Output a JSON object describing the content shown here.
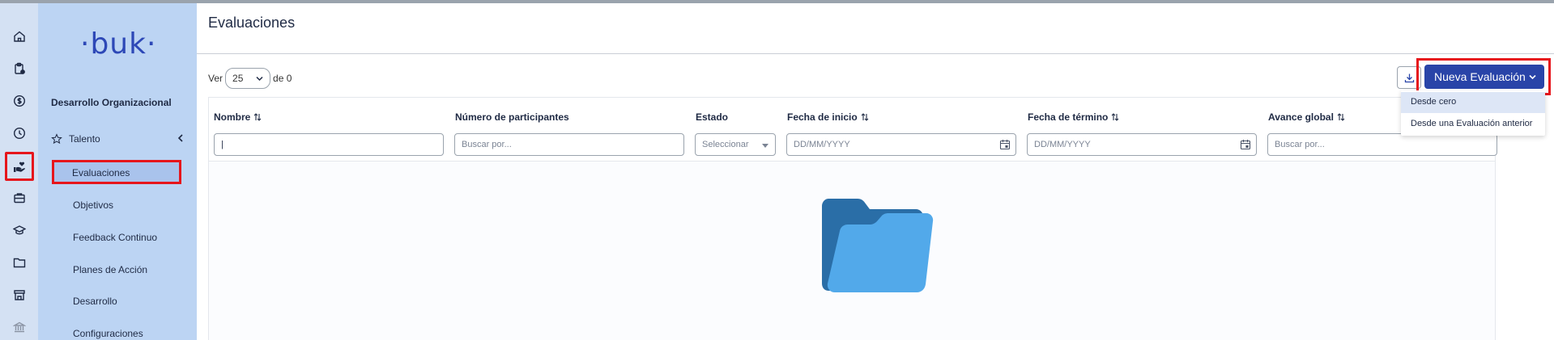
{
  "colors": {
    "brand": "#2944a8",
    "sidebar_bg": "#bcd4f3",
    "rail_bg": "#d4e1f3",
    "highlight": "#e6161c",
    "folder_dark": "#2a6ea7",
    "folder_light": "#52a9ea"
  },
  "app": {
    "logo_text": "·buk·"
  },
  "rail": {
    "icons": [
      "home-icon",
      "clipboard-icon",
      "dollar-icon",
      "clock-icon",
      "hand-heart-icon",
      "briefcase-icon",
      "graduation-cap-icon",
      "folder-icon",
      "store-icon",
      "bank-icon"
    ],
    "active_icon": "hand-heart-icon"
  },
  "sidebar": {
    "module_title": "Desarrollo Organizacional",
    "group_label": "Talento",
    "items": [
      {
        "label": "Evaluaciones",
        "selected": true
      },
      {
        "label": "Objetivos"
      },
      {
        "label": "Feedback Continuo"
      },
      {
        "label": "Planes de Acción"
      },
      {
        "label": "Desarrollo"
      },
      {
        "label": "Configuraciones"
      }
    ]
  },
  "page": {
    "title": "Evaluaciones"
  },
  "pagination": {
    "prefix": "Ver",
    "per_page": "25",
    "suffix": "de 0"
  },
  "actions": {
    "new_evaluation_label": "Nueva Evaluación",
    "download_icon": "download-icon"
  },
  "dropdown": {
    "items": [
      "Desde cero",
      "Desde una Evaluación anterior"
    ]
  },
  "table": {
    "columns": [
      {
        "label": "Nombre",
        "sortable": true,
        "filter_value": "|",
        "filter_placeholder": ""
      },
      {
        "label": "Número de participantes",
        "sortable": false,
        "filter_placeholder": "Buscar por..."
      },
      {
        "label": "Estado",
        "sortable": false,
        "filter_placeholder": "Seleccionar"
      },
      {
        "label": "Fecha de inicio",
        "sortable": true,
        "filter_placeholder": "DD/MM/YYYY"
      },
      {
        "label": "Fecha de término",
        "sortable": true,
        "filter_placeholder": "DD/MM/YYYY"
      },
      {
        "label": "Avance global",
        "sortable": true,
        "filter_placeholder": "Buscar por..."
      }
    ],
    "rows": []
  }
}
